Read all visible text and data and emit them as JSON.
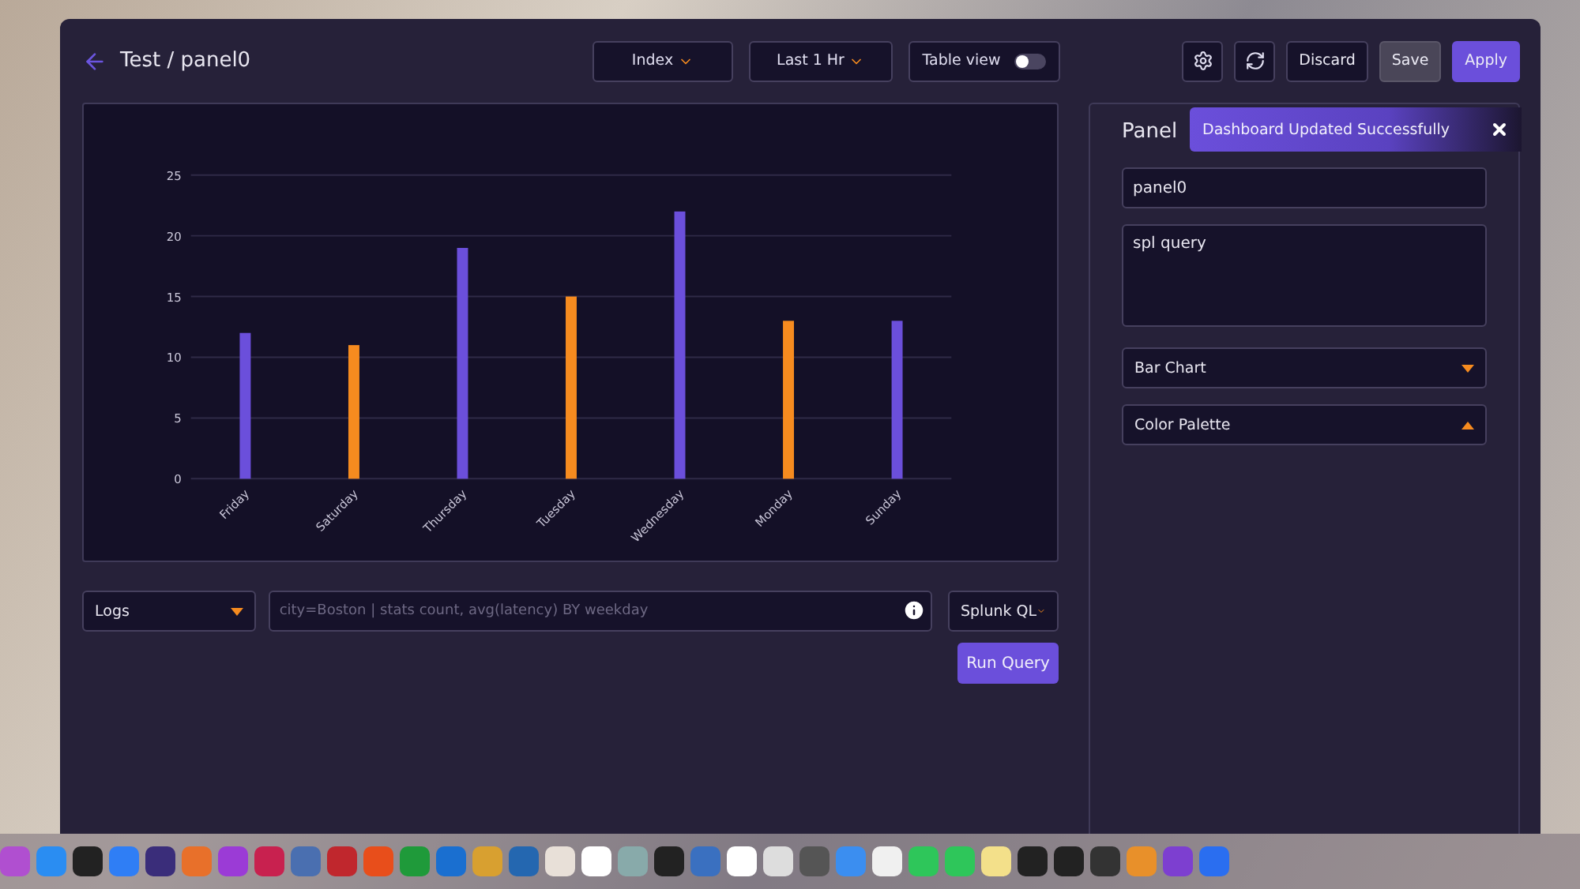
{
  "window": {
    "title": "Test / panel0"
  },
  "toolbar": {
    "index_select": "Index",
    "time_select": "Last 1 Hr",
    "table_view": {
      "label": "Table view",
      "on": false
    },
    "buttons": [
      {
        "label": "Discard",
        "kind": "outline"
      },
      {
        "label": "Save",
        "kind": "secondary"
      },
      {
        "label": "Apply",
        "kind": "primary"
      }
    ]
  },
  "chart": {
    "chart_data": {
      "type": "bar",
      "categories": [
        "Friday",
        "Saturday",
        "Thursday",
        "Tuesday",
        "Wednesday",
        "Monday",
        "Sunday"
      ],
      "series": [
        {
          "color": "#6b4fdb",
          "values": [
            12,
            null,
            19,
            null,
            22,
            null,
            13
          ]
        },
        {
          "color": "#f68b1f",
          "values": [
            null,
            11,
            null,
            15,
            null,
            13,
            null
          ]
        }
      ],
      "grid": true,
      "ylim": [
        0,
        25
      ],
      "yticks": [
        0,
        5,
        10,
        15,
        20,
        25
      ]
    }
  },
  "query": {
    "source": "Logs",
    "placeholder": "city=Boston | stats count, avg(latency) BY weekday",
    "language": "Splunk QL",
    "run_button": "Run Query"
  },
  "panel": {
    "title": "Panel",
    "name": "panel0",
    "query": "spl query",
    "selects": [
      {
        "label": "Bar Chart",
        "expanded": false
      },
      {
        "label": "Color Palette",
        "expanded": true
      }
    ]
  },
  "toast": {
    "message": "Dashboard Updated Successfully"
  }
}
